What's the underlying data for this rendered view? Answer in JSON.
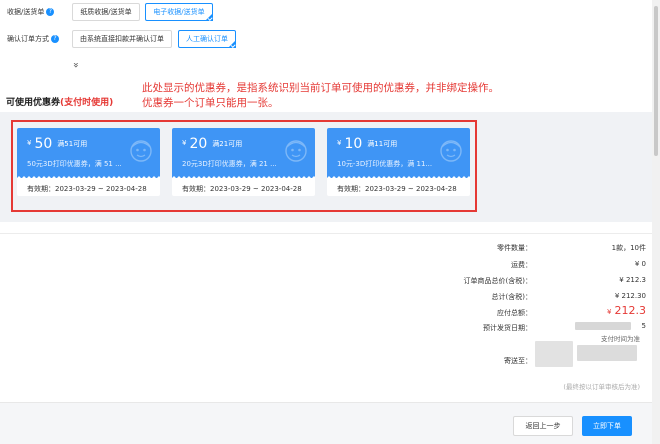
{
  "receipt": {
    "label": "收据/送货单",
    "help": "?",
    "options": [
      "纸质收据/送货单",
      "电子收据/送货单"
    ],
    "selected": "电子收据/送货单"
  },
  "confirm": {
    "label": "确认订单方式",
    "help": "?",
    "options": [
      "由系统直接扣款并确认订单",
      "人工确认订单"
    ],
    "selected": "人工确认订单"
  },
  "expand": "»",
  "note": {
    "line1": "此处显示的优惠券，是指系统识别当前订单可使用的优惠券，并非绑定操作。",
    "line2": "优惠券一个订单只能用一张。"
  },
  "coupons_section": {
    "title": "可使用优惠券",
    "title_note": "(支付时使用)",
    "coupons": [
      {
        "currency": "¥",
        "amount": "50",
        "condition": "满51可用",
        "desc": "50元3D打印优惠券，满 51 ...",
        "validity": "有效期：2023-03-29 ~ 2023-04-28"
      },
      {
        "currency": "¥",
        "amount": "20",
        "condition": "满21可用",
        "desc": "20元3D打印优惠券，满 21 ...",
        "validity": "有效期：2023-03-29 ~ 2023-04-28"
      },
      {
        "currency": "¥",
        "amount": "10",
        "condition": "满11可用",
        "desc": "10元-3D打印优惠券，满 11...",
        "validity": "有效期：2023-03-29 ~ 2023-04-28"
      }
    ]
  },
  "summary": {
    "parts_label": "零件数量：",
    "parts_value": "1款，10件",
    "shipping_label": "运费：",
    "shipping_value": "¥ 0",
    "goods_total_label": "订单商品总价(含税)：",
    "goods_total_value": "¥ 212.3",
    "total_label": "总计(含税)：",
    "total_value": "¥ 212.30",
    "payable_label": "应付总额：",
    "payable_currency": "¥",
    "payable_value": "212.3",
    "delivery_label": "预计发货日期：",
    "delivery_value": "5",
    "delivery_note": "支付时间为准",
    "ship_to_label": "寄送至：",
    "footnote": "(最终按以订单审核后为准)"
  },
  "footer": {
    "back_label": "返回上一步",
    "order_label": "立即下单"
  },
  "colors": {
    "accent": "#1890ff",
    "coupon_blue": "#3f95f5",
    "alert_red": "#e53935"
  }
}
